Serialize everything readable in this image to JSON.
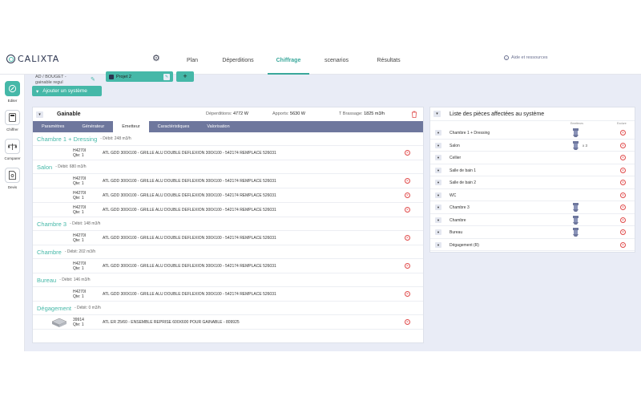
{
  "app": {
    "logo_text": "CALIXTA"
  },
  "nav": {
    "tabs": [
      {
        "label": "Plan"
      },
      {
        "label": "Déperditions"
      },
      {
        "label": "Chiffrage",
        "active": true
      },
      {
        "label": "scenarios"
      },
      {
        "label": "Résultats"
      }
    ],
    "help_label": "Aide et ressources"
  },
  "sidebar": {
    "items": [
      {
        "label": "Editer",
        "icon": "edit-icon",
        "active": true
      },
      {
        "label": "Chiffrer",
        "icon": "calculator-icon"
      },
      {
        "label": "Comparer",
        "icon": "scale-icon"
      },
      {
        "label": "Devis",
        "icon": "document-icon"
      }
    ]
  },
  "header": {
    "breadcrumb": "AD / BOUGET - gainable regul",
    "project_tab": "Projet 2",
    "add_tab": "+",
    "add_system_label": "Ajouter un système"
  },
  "system": {
    "name": "Gainable",
    "deperditions_label": "Déperditions:",
    "deperditions_value": "4772 W",
    "apports_label": "Apports:",
    "apports_value": "5630 W",
    "brassage_label": "T Brassage:",
    "brassage_value": "1825 m3/h",
    "subtabs": [
      {
        "label": "Paramètres"
      },
      {
        "label": "Générateur"
      },
      {
        "label": "Emetteur",
        "active": true
      },
      {
        "label": "Caractéristiques"
      },
      {
        "label": "Valorisation"
      }
    ]
  },
  "rooms": [
    {
      "name": "Chambre 1 + Dressing",
      "debit": "- Débit: 248 m3/h",
      "products": [
        {
          "ref": "H4270I",
          "qte": "Qte: 1",
          "desc": "ATL GDD 300X100 - GRILLE ALU DOUBLE DEFLEXION 300X100 - 542174 REMPLACE 526031"
        }
      ]
    },
    {
      "name": "Salon",
      "debit": "- Débit: 680 m3/h",
      "products": [
        {
          "ref": "H4270I",
          "qte": "Qte: 1",
          "desc": "ATL GDD 300X100 - GRILLE ALU DOUBLE DEFLEXION 300X100 - 542174 REMPLACE 526031"
        },
        {
          "ref": "H4270I",
          "qte": "Qte: 1",
          "desc": "ATL GDD 300X100 - GRILLE ALU DOUBLE DEFLEXION 300X100 - 542174 REMPLACE 526031"
        },
        {
          "ref": "H4270I",
          "qte": "Qte: 1",
          "desc": "ATL GDD 300X100 - GRILLE ALU DOUBLE DEFLEXION 300X100 - 542174 REMPLACE 526031"
        }
      ]
    },
    {
      "name": "Chambre 3",
      "debit": "- Débit: 148 m3/h",
      "products": [
        {
          "ref": "H4270I",
          "qte": "Qte: 1",
          "desc": "ATL GDD 300X100 - GRILLE ALU DOUBLE DEFLEXION 300X100 - 542174 REMPLACE 526031"
        }
      ]
    },
    {
      "name": "Chambre",
      "debit": "- Débit: 202 m3/h",
      "products": [
        {
          "ref": "H4270I",
          "qte": "Qte: 1",
          "desc": "ATL GDD 300X100 - GRILLE ALU DOUBLE DEFLEXION 300X100 - 542174 REMPLACE 526031"
        }
      ]
    },
    {
      "name": "Bureau",
      "debit": "- Débit: 146 m3/h",
      "products": [
        {
          "ref": "H4270I",
          "qte": "Qte: 1",
          "desc": "ATL GDD 300X100 - GRILLE ALU DOUBLE DEFLEXION 300X100 - 542174 REMPLACE 526031"
        }
      ]
    },
    {
      "name": "Dégagement",
      "debit": "- Débit: 0 m3/h",
      "products": [
        {
          "ref": "39914",
          "qte": "Qte: 1",
          "desc": "ATL ER 25/60 - ENSEMBLE REPRISE 600X600 POUR GAINABLE - 809925",
          "has_image": true
        }
      ]
    }
  ],
  "right_panel": {
    "title": "Liste des pièces affectées au système",
    "col_emetteurs": "Emetteurs",
    "col_exclure": "Exclure",
    "rows": [
      {
        "name": "Chambre 1 + Dressing",
        "emitter": true
      },
      {
        "name": "Salon",
        "emitter": true,
        "count": "x 3"
      },
      {
        "name": "Cellier"
      },
      {
        "name": "Salle de bain 1"
      },
      {
        "name": "Salle de bain 2"
      },
      {
        "name": "WC"
      },
      {
        "name": "Chambre 3",
        "emitter": true
      },
      {
        "name": "Chambre",
        "emitter": true
      },
      {
        "name": "Bureau",
        "emitter": true
      },
      {
        "name": "Dégagement (R)"
      }
    ]
  },
  "colors": {
    "accent": "#45b8a8",
    "subtab_bar": "#6e779d",
    "content_bg": "#e9ecf6",
    "danger": "#e04b4b"
  }
}
